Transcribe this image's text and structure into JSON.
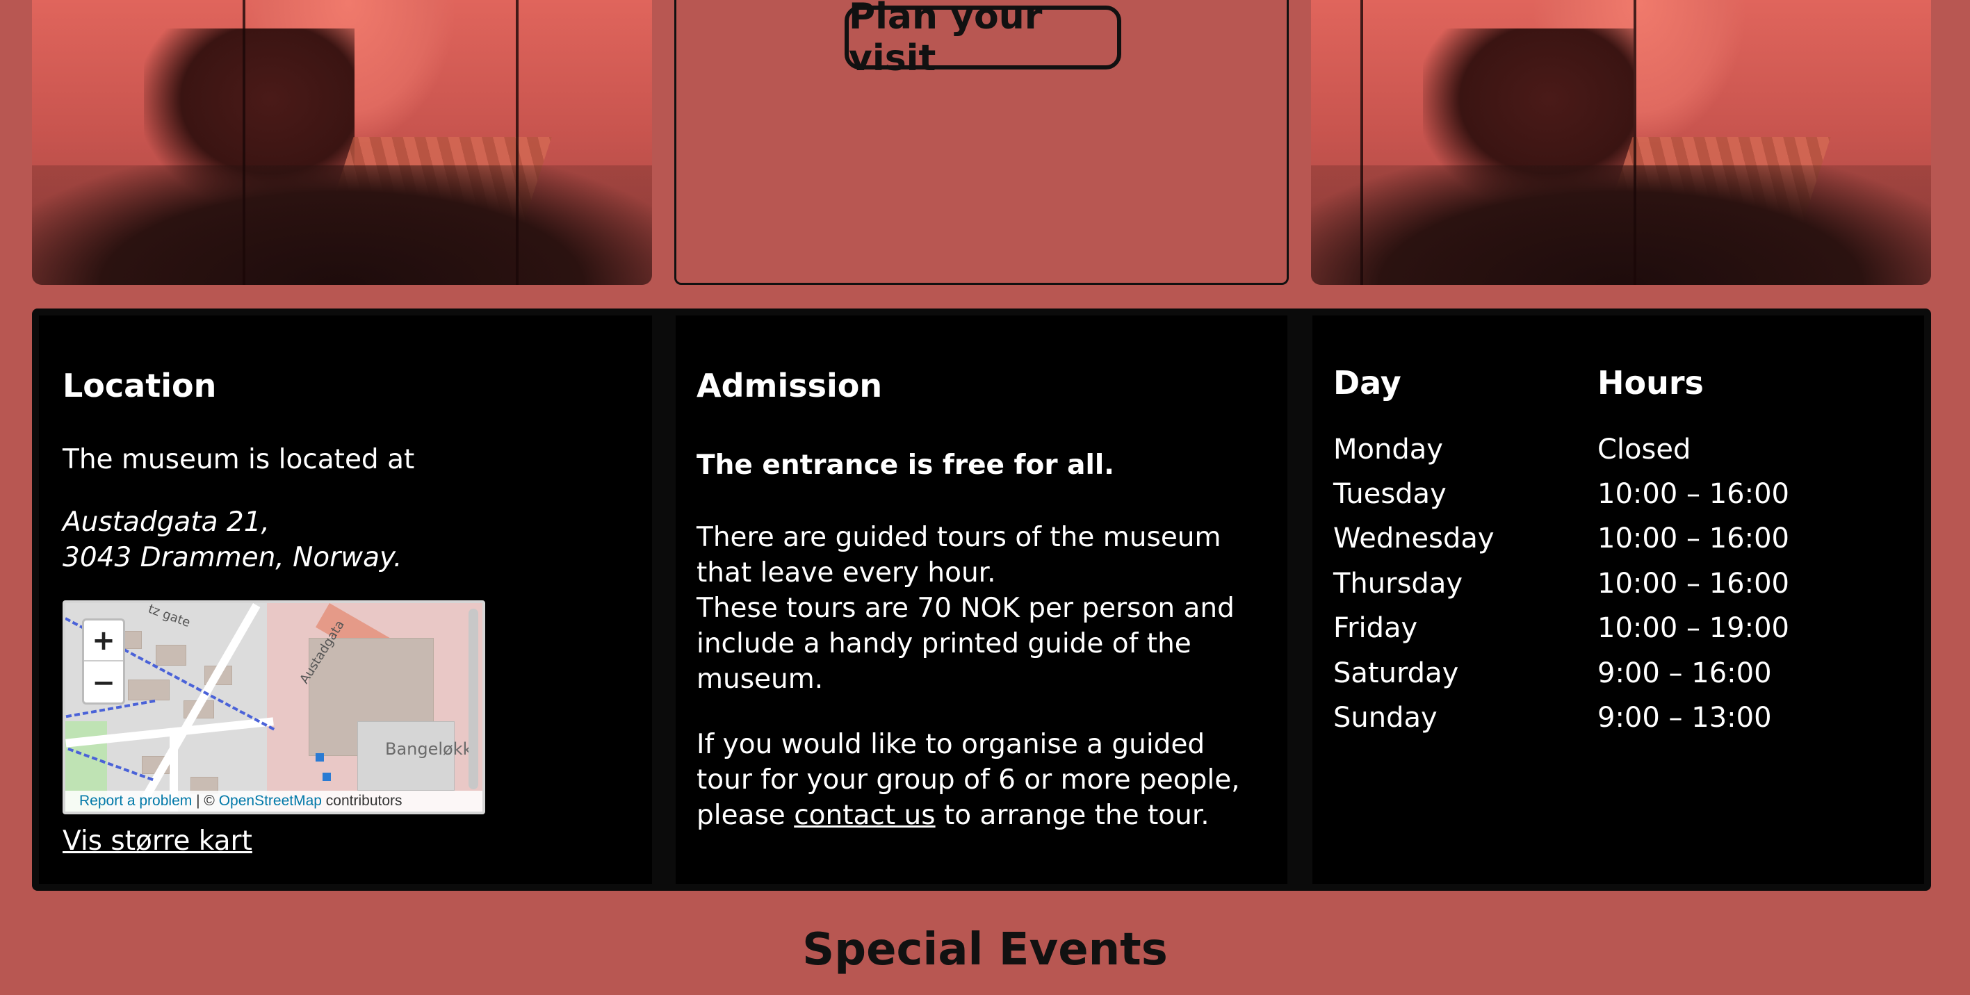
{
  "plan": {
    "button_label": "Plan your visit"
  },
  "location": {
    "heading": "Location",
    "lead": "The museum is located at",
    "address_line1": "Austadgata 21,",
    "address_line2": "3043 Drammen, Norway.",
    "larger_map_link": "Vis større kart",
    "map": {
      "zoom_in": "+",
      "zoom_out": "−",
      "street_label_1": "tz gate",
      "street_label_2": "Austadgata",
      "place_label": "Bangeløkk",
      "report_link": "Report a problem",
      "attribution_separator": " | © ",
      "osm_link": "OpenStreetMap",
      "attribution_suffix": " contributors"
    }
  },
  "admission": {
    "heading": "Admission",
    "free": "The entrance is free for all.",
    "tours_line1": "There are guided tours of the museum",
    "tours_line2": "that leave every hour.",
    "tours_line3": "These tours are 70 NOK per person and",
    "tours_line4": "include a handy printed guide of the",
    "tours_line5": "museum.",
    "group_line1": "If you would like to organise a guided",
    "group_line2": "tour for your group of 6 or more people,",
    "group_prefix": "please ",
    "contact_link": "contact us",
    "group_suffix": " to arrange the tour."
  },
  "hours": {
    "day_header": "Day",
    "hours_header": "Hours",
    "rows": [
      {
        "day": "Monday",
        "hours": "Closed"
      },
      {
        "day": "Tuesday",
        "hours": "10:00 – 16:00"
      },
      {
        "day": "Wednesday",
        "hours": "10:00 – 16:00"
      },
      {
        "day": "Thursday",
        "hours": "10:00 – 16:00"
      },
      {
        "day": "Friday",
        "hours": "10:00 – 19:00"
      },
      {
        "day": "Saturday",
        "hours": "9:00 – 16:00"
      },
      {
        "day": "Sunday",
        "hours": "9:00 – 13:00"
      }
    ]
  },
  "special_events": {
    "heading": "Special Events"
  },
  "colors": {
    "page_background": "#b85752",
    "panel_background": "#000000",
    "link": "#0078a8"
  }
}
